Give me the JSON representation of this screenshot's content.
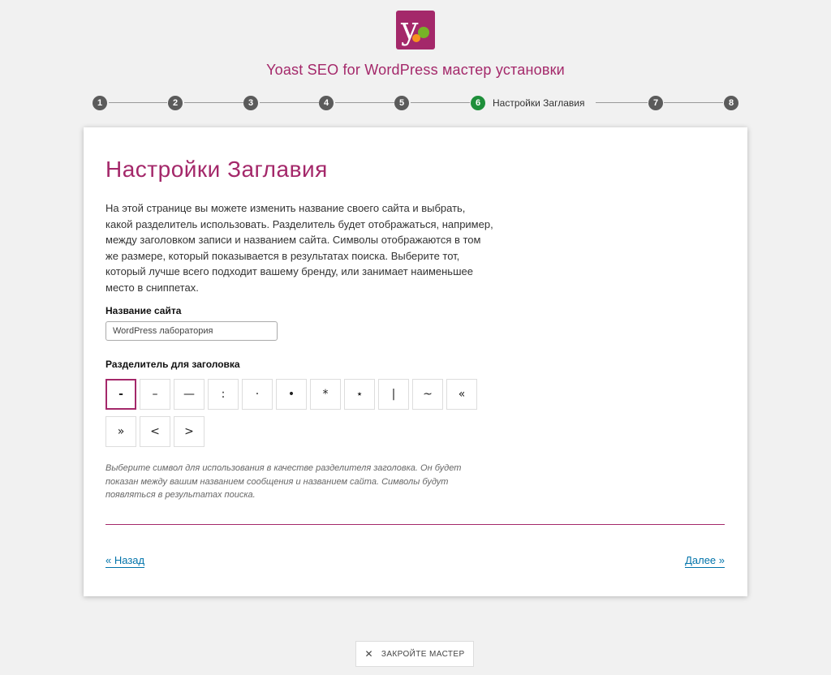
{
  "wizard": {
    "title": "Yoast SEO for WordPress мастер установки"
  },
  "steps": [
    {
      "number": "1",
      "label": "",
      "active": false
    },
    {
      "number": "2",
      "label": "",
      "active": false
    },
    {
      "number": "3",
      "label": "",
      "active": false
    },
    {
      "number": "4",
      "label": "",
      "active": false
    },
    {
      "number": "5",
      "label": "",
      "active": false
    },
    {
      "number": "6",
      "label": "Настройки Заглавия",
      "active": true
    },
    {
      "number": "7",
      "label": "",
      "active": false
    },
    {
      "number": "8",
      "label": "",
      "active": false
    }
  ],
  "content": {
    "heading": "Настройки Заглавия",
    "intro": "На этой странице вы можете изменить название своего сайта и выбрать, какой разделитель использовать. Разделитель будет отображаться, например, между заголовком записи и названием сайта. Символы отображаются в том же размере, который показывается в результатах поиска. Выберите тот, который лучше всего подходит вашему бренду, или занимает наименьшее место в сниппетах.",
    "site_name_label": "Название сайта",
    "site_name_value": "WordPress лаборатория",
    "separator_label": "Разделитель для заголовка",
    "separators": [
      "-",
      "–",
      "—",
      ":",
      "·",
      "•",
      "*",
      "⋆",
      "|",
      "~",
      "«",
      "»",
      "<",
      ">"
    ],
    "selected_separator": "-",
    "help_text": "Выберите символ для использования в качестве разделителя заголовка. Он будет показан между вашим названием сообщения и названием сайта. Символы будут появляться в результатах поиска."
  },
  "nav": {
    "back": "« Назад",
    "next": "Далее »"
  },
  "footer": {
    "close_label": "ЗАКРОЙТЕ МАСТЕР",
    "close_icon": "close-icon"
  },
  "colors": {
    "brand": "#a4286a",
    "active_step": "#1e8f3a",
    "link": "#0073aa"
  }
}
